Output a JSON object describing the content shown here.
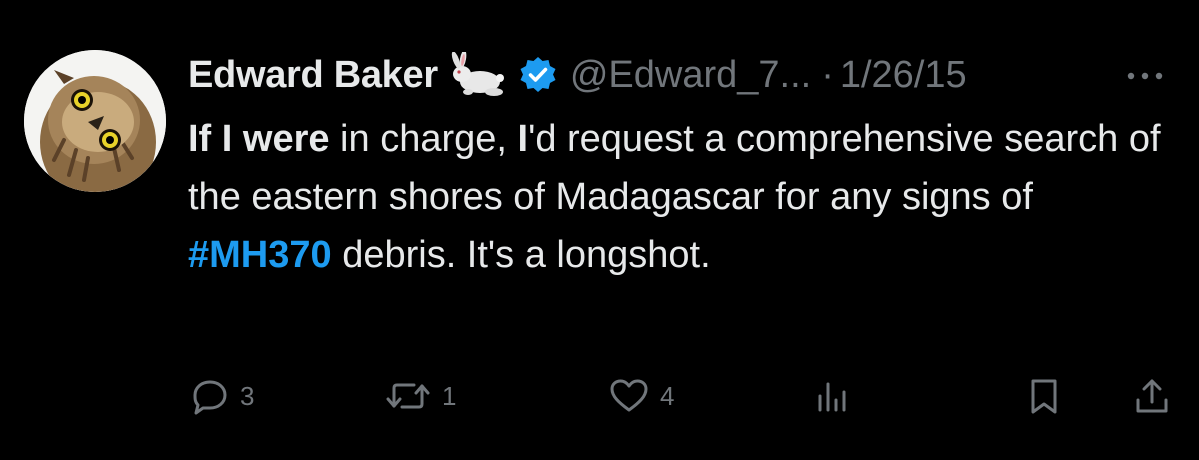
{
  "author": {
    "display_name": "Edward Baker",
    "handle": "@Edward_7...",
    "separator": "·",
    "date": "1/26/15",
    "verified": true,
    "name_emoji": "rabbit"
  },
  "tweet": {
    "segments": [
      {
        "text": "If I were",
        "style": "bold"
      },
      {
        "text": " in charge, ",
        "style": "normal"
      },
      {
        "text": "I",
        "style": "bold"
      },
      {
        "text": "'d request a comprehensive search of the eastern shores of Madagascar for any signs of ",
        "style": "normal"
      },
      {
        "text": "#MH370",
        "style": "hashtag"
      },
      {
        "text": " debris. It's a longshot.",
        "style": "normal"
      }
    ]
  },
  "actions": {
    "replies": "3",
    "retweets": "1",
    "likes": "4"
  },
  "colors": {
    "background": "#000000",
    "text": "#e7e9ea",
    "muted": "#71767b",
    "accent": "#1d9bf0"
  },
  "icons": [
    "owl-avatar",
    "rabbit-emoji",
    "verified-badge-icon",
    "more-icon",
    "reply-icon",
    "retweet-icon",
    "like-icon",
    "views-icon",
    "bookmark-icon",
    "share-icon"
  ]
}
